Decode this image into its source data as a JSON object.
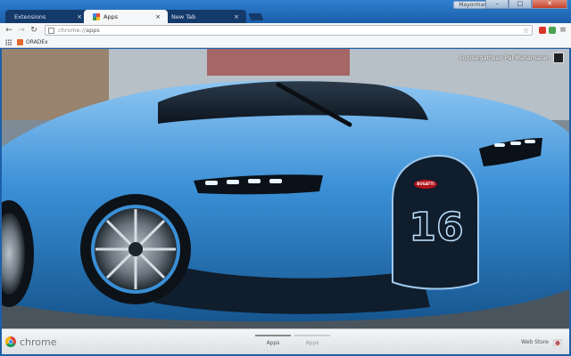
{
  "window": {
    "profile_label": "Mayorman",
    "controls": {
      "minimize": "–",
      "maximize": "□",
      "close": "✕"
    }
  },
  "tabs": [
    {
      "label": "Extensions",
      "close": "×",
      "icon": "puzzle-icon"
    },
    {
      "label": "Apps",
      "close": "×",
      "icon": "apps-icon"
    },
    {
      "label": "New Tab",
      "close": "×",
      "icon": "none"
    }
  ],
  "toolbar": {
    "back": "←",
    "forward": "→",
    "reload": "↻",
    "url_scheme": "chrome://",
    "url_path": "apps",
    "star": "☆",
    "menu": "≡"
  },
  "bookmarks": {
    "items": [
      {
        "label": "ORADEx"
      }
    ]
  },
  "content": {
    "user_name": "Sundargathsan Pal Mahamaran",
    "car_badge": "BUGATTI",
    "car_number": "16"
  },
  "footer": {
    "logo_text": "chrome",
    "pages": [
      {
        "label": "Apps",
        "active": true
      },
      {
        "label": "Apps",
        "active": false
      }
    ],
    "web_store_label": "Web Store"
  },
  "colors": {
    "frame_top": "#2f7fd0",
    "frame_bottom": "#1a5ea9",
    "inactive_tab": "#143a6b",
    "active_tab": "#f5f6f7",
    "car_blue": "#3a8fd6",
    "car_dark": "#0f1d2c"
  }
}
